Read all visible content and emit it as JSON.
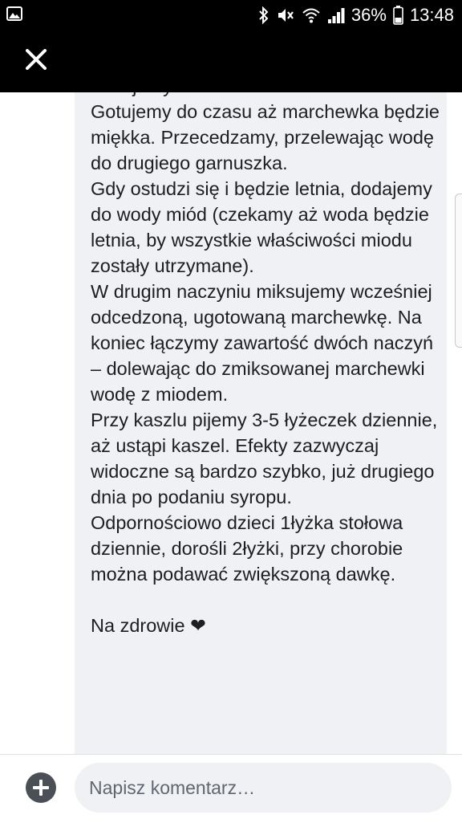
{
  "status_bar": {
    "battery": "36%",
    "time": "13:48",
    "icons": [
      "gallery-icon",
      "bluetooth-icon",
      "mute-icon",
      "wifi-icon",
      "signal-icon",
      "battery-icon"
    ]
  },
  "toolbar": {
    "close_icon": "close-icon"
  },
  "message": {
    "text": "dodajemy imbir.\nGotujemy do czasu aż marchewka będzie miękka. Przecedzamy, przelewając wodę do drugiego garnuszka.\nGdy ostudzi się i będzie letnia, dodajemy do wody miód (czekamy aż woda będzie letnia, by wszystkie właściwości miodu zostały utrzymane).\nW drugim naczyniu miksujemy wcześniej odcedzoną, ugotowaną marchewkę. Na koniec łączymy zawartość dwóch naczyń – dolewając do zmiksowanej marchewki wodę z miodem.\nPrzy kaszlu pijemy 3-5 łyżeczek dziennie, aż ustąpi kaszel. Efekty zazwyczaj widoczne są bardzo szybko, już drugiego dnia po podaniu syropu.\nOdpornościowo dzieci 1łyżka stołowa dziennie, dorośli 2łyżki, przy chorobie można podawać zwiększoną dawkę.\n\nNa zdrowie ❤"
  },
  "composer": {
    "add_icon": "plus-circle-icon",
    "placeholder": "Napisz komentarz…"
  }
}
